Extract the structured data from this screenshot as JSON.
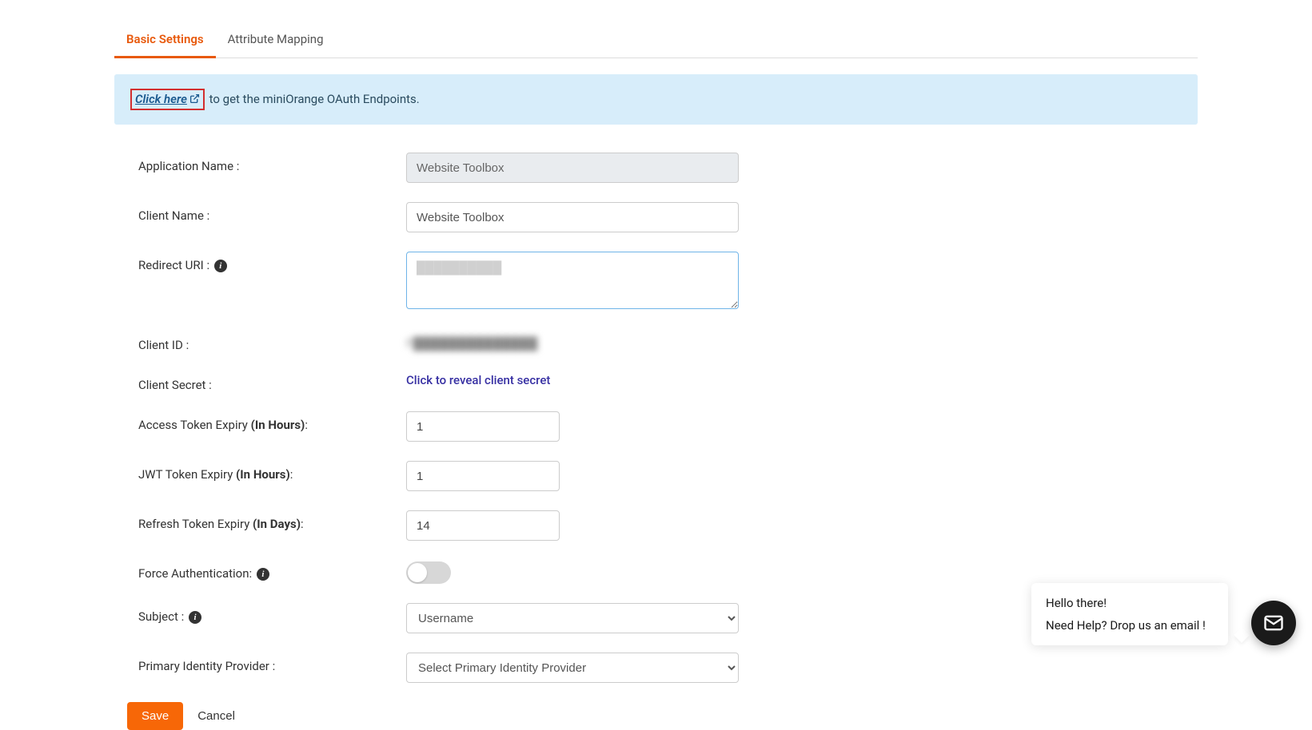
{
  "tabs": {
    "basic": "Basic Settings",
    "attr": "Attribute Mapping"
  },
  "alert": {
    "link": "Click here",
    "rest": " to get the miniOrange OAuth Endpoints."
  },
  "labels": {
    "appName": "Application Name :",
    "clientName": "Client Name :",
    "redirect": "Redirect URI :",
    "clientId": "Client ID :",
    "clientSecret": "Client Secret :",
    "accessExp_a": "Access Token Expiry ",
    "accessExp_b": "(In Hours)",
    "accessExp_c": ":",
    "jwtExp_a": "JWT Token Expiry ",
    "jwtExp_b": "(In Hours)",
    "jwtExp_c": ":",
    "refreshExp_a": "Refresh Token Expiry ",
    "refreshExp_b": "(In Days)",
    "refreshExp_c": ":",
    "forceAuth": "Force Authentication:",
    "subject": "Subject :",
    "primaryIdp": "Primary Identity Provider :"
  },
  "values": {
    "appName": "Website Toolbox",
    "clientName": "Website Toolbox",
    "redirectPh": "██████████",
    "clientId": "F██████████████",
    "reveal": "Click to reveal client secret",
    "accessExp": "1",
    "jwtExp": "1",
    "refreshExp": "14"
  },
  "selects": {
    "subject": "Username",
    "primaryIdp": "Select Primary Identity Provider"
  },
  "actions": {
    "save": "Save",
    "cancel": "Cancel"
  },
  "chat": {
    "line1": "Hello there!",
    "line2": "Need Help? Drop us an email !"
  }
}
